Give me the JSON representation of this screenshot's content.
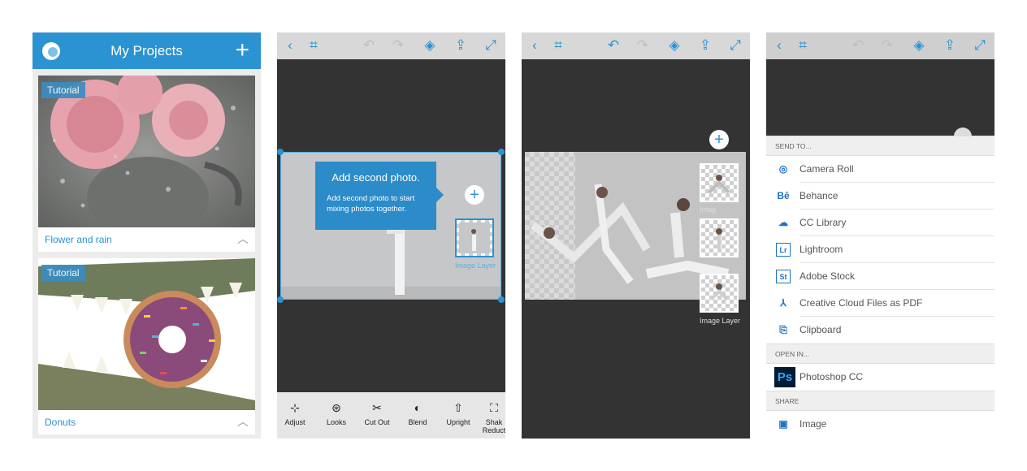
{
  "screen1": {
    "title": "My Projects",
    "plus": "+",
    "projects": [
      {
        "tag": "Tutorial",
        "caption": "Flower and rain"
      },
      {
        "tag": "Tutorial",
        "caption": "Donuts"
      }
    ],
    "chevron": "︿"
  },
  "editor_icons": {
    "back": "‹",
    "crop": "⌗",
    "undo": "↶",
    "redo": "↷",
    "layers": "◈",
    "share": "⇪",
    "expand": "⤢"
  },
  "screen2": {
    "tooltip_title": "Add second photo.",
    "tooltip_body": "Add second photo to start mixing photos together.",
    "plus": "+",
    "layer_label": "Image Layer",
    "tools": [
      {
        "icon": "⊹",
        "label": "Adjust"
      },
      {
        "icon": "⊛",
        "label": "Looks"
      },
      {
        "icon": "✂",
        "label": "Cut Out"
      },
      {
        "icon": "◐",
        "label": "Blend"
      },
      {
        "icon": "⇧",
        "label": "Upright"
      },
      {
        "icon": "⛶",
        "label": "Shak Reduct"
      }
    ]
  },
  "screen3": {
    "plus": "+",
    "layer_label_top": "Imag",
    "layer_label_bottom": "Image Layer"
  },
  "screen4": {
    "send_to": "SEND TO...",
    "send_items": [
      {
        "icon": "◎",
        "label": "Camera Roll"
      },
      {
        "icon": "Bē",
        "label": "Behance"
      },
      {
        "icon": "☁",
        "label": "CC Library"
      },
      {
        "icon": "Lr",
        "label": "Lightroom"
      },
      {
        "icon": "St",
        "label": "Adobe Stock"
      },
      {
        "icon": "⅄",
        "label": "Creative Cloud Files as PDF"
      },
      {
        "icon": "⎘",
        "label": "Clipboard"
      }
    ],
    "open_in": "OPEN IN...",
    "open_items": [
      {
        "icon": "Ps",
        "label": "Photoshop CC"
      }
    ],
    "share": "SHARE",
    "share_items": [
      {
        "icon": "▣",
        "label": "Image"
      }
    ]
  },
  "colors": {
    "accent": "#2b93d1",
    "dark": "#333333",
    "toolbar": "#e6e6e6"
  }
}
